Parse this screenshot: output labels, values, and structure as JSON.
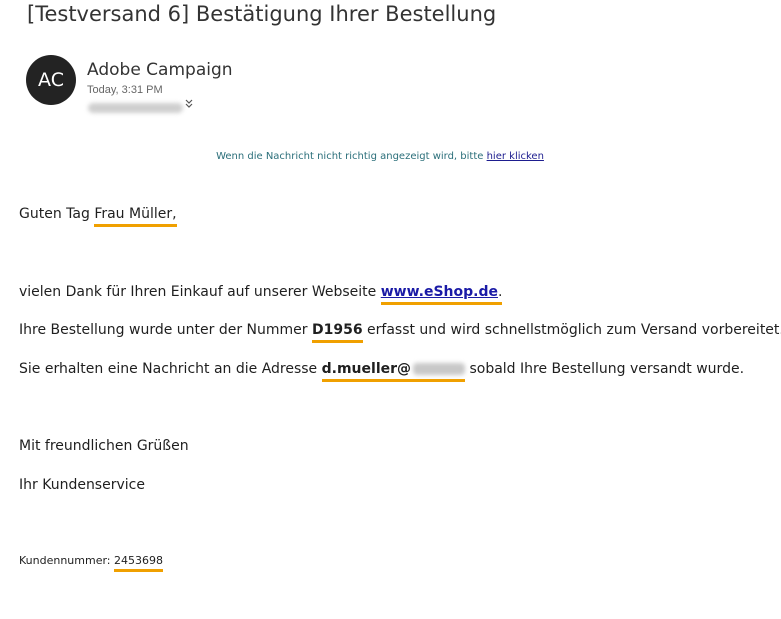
{
  "email": {
    "subject": "[Testversand 6] Bestätigung Ihrer Bestellung",
    "sender_initials": "AC",
    "sender_name": "Adobe Campaign",
    "timestamp": "Today, 3:31 PM",
    "expand_icon": "chevron-down-icon"
  },
  "notice": {
    "text": "Wenn die Nachricht nicht richtig angezeigt wird, bitte ",
    "link": "hier klicken"
  },
  "body": {
    "greeting_prefix": "Guten Tag ",
    "greeting_name": "Frau Müller",
    "greeting_suffix": ",",
    "thanks_prefix": "vielen Dank für Ihren Einkauf auf unserer Webseite ",
    "shop_link": "www.eShop.de",
    "thanks_suffix": ".",
    "order_prefix": "Ihre Bestellung wurde unter der Nummer ",
    "order_number": "D1956",
    "order_suffix": " erfasst und wird schnellstmöglich zum Versand vorbereitet.",
    "notify_prefix": "Sie erhalten eine Nachricht an die Adresse ",
    "email_address": "d.mueller@",
    "notify_suffix": " sobald Ihre Bestellung versandt wurde.",
    "closing": "Mit freundlichen Grüßen",
    "signature": "Ihr Kundenservice",
    "customer_label": "Kundennummer: ",
    "customer_number": "2453698"
  },
  "colors": {
    "highlight": "#f0a000",
    "link": "#1a1aa6",
    "avatar": "#232323"
  }
}
